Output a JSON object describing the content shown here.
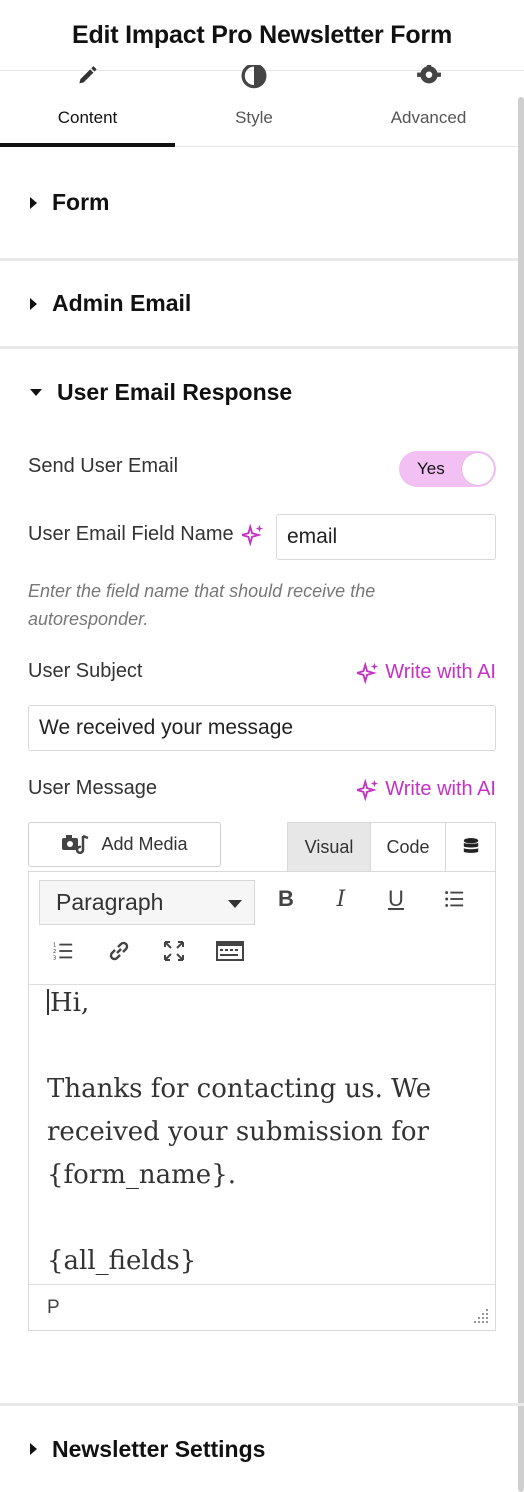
{
  "header": {
    "title": "Edit Impact Pro Newsletter Form"
  },
  "tabs": [
    {
      "label": "Content",
      "icon": "pencil-icon",
      "active": true
    },
    {
      "label": "Style",
      "icon": "contrast-icon",
      "active": false
    },
    {
      "label": "Advanced",
      "icon": "gear-icon",
      "active": false
    }
  ],
  "sections": {
    "form": "Form",
    "admin_email": "Admin Email",
    "user_email_response": "User Email Response",
    "newsletter_settings": "Newsletter Settings"
  },
  "user_email": {
    "send_label": "Send User Email",
    "send_toggle": "Yes",
    "field_name_label": "User Email Field Name",
    "field_name_value": "email",
    "field_hint": "Enter the field name that should receive the autoresponder.",
    "subject_label": "User Subject",
    "subject_value": "We received your message",
    "message_label": "User Message",
    "write_ai": "Write with AI"
  },
  "editor": {
    "add_media": "Add Media",
    "tab_visual": "Visual",
    "tab_code": "Code",
    "format_select": "Paragraph",
    "toolbar_bold": "B",
    "toolbar_italic": "I",
    "toolbar_underline": "U",
    "lines": {
      "greeting": "Hi,",
      "body": "Thanks for contacting us. We received your submission for {form_name}.",
      "fields": "{all_fields}"
    },
    "status_path": "P"
  },
  "colors": {
    "accent": "#c530c5",
    "toggle_bg": "#f3c0f3"
  }
}
